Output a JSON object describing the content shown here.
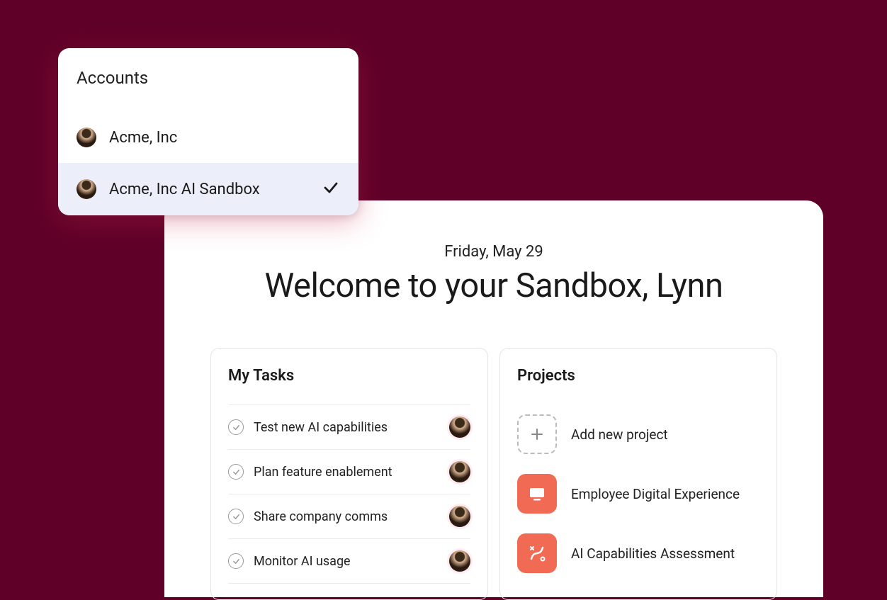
{
  "accounts": {
    "title": "Accounts",
    "items": [
      {
        "label": "Acme, Inc",
        "selected": false
      },
      {
        "label": "Acme, Inc AI Sandbox",
        "selected": true
      }
    ]
  },
  "header": {
    "date": "Friday, May 29",
    "welcome": "Welcome to your Sandbox, Lynn"
  },
  "tasks": {
    "title": "My Tasks",
    "items": [
      {
        "label": "Test new AI capabilities"
      },
      {
        "label": "Plan feature enablement"
      },
      {
        "label": "Share company comms"
      },
      {
        "label": "Monitor AI usage"
      }
    ]
  },
  "projects": {
    "title": "Projects",
    "add_label": "Add new project",
    "items": [
      {
        "label": "Employee Digital Experience",
        "icon": "monitor"
      },
      {
        "label": "AI Capabilities Assessment",
        "icon": "flow"
      }
    ]
  }
}
